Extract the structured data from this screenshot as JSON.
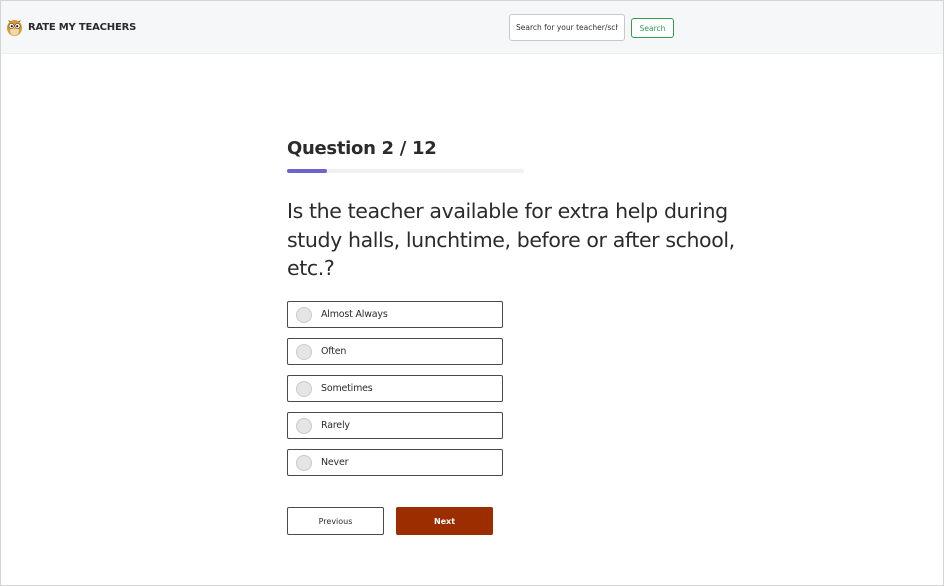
{
  "header": {
    "logo_text": "RATE MY TEACHERS",
    "logo_icon": "owl-icon",
    "search_placeholder": "Search for your teacher/school",
    "search_button": "Search"
  },
  "survey": {
    "counter": "Question 2 / 12",
    "progress_fraction": 0.1667,
    "progress_color": "#6c63cc",
    "question": "Is the teacher available for extra help during study halls, lunchtime, before or after school, etc.?",
    "options": [
      {
        "label": "Almost Always",
        "selected": false
      },
      {
        "label": "Often",
        "selected": false
      },
      {
        "label": "Sometimes",
        "selected": false
      },
      {
        "label": "Rarely",
        "selected": false
      },
      {
        "label": "Never",
        "selected": false
      }
    ],
    "previous_label": "Previous",
    "next_label": "Next"
  },
  "colors": {
    "accent_next": "#9b2d00",
    "search_green": "#2e9e4f",
    "header_bg": "#f6f7f8"
  }
}
